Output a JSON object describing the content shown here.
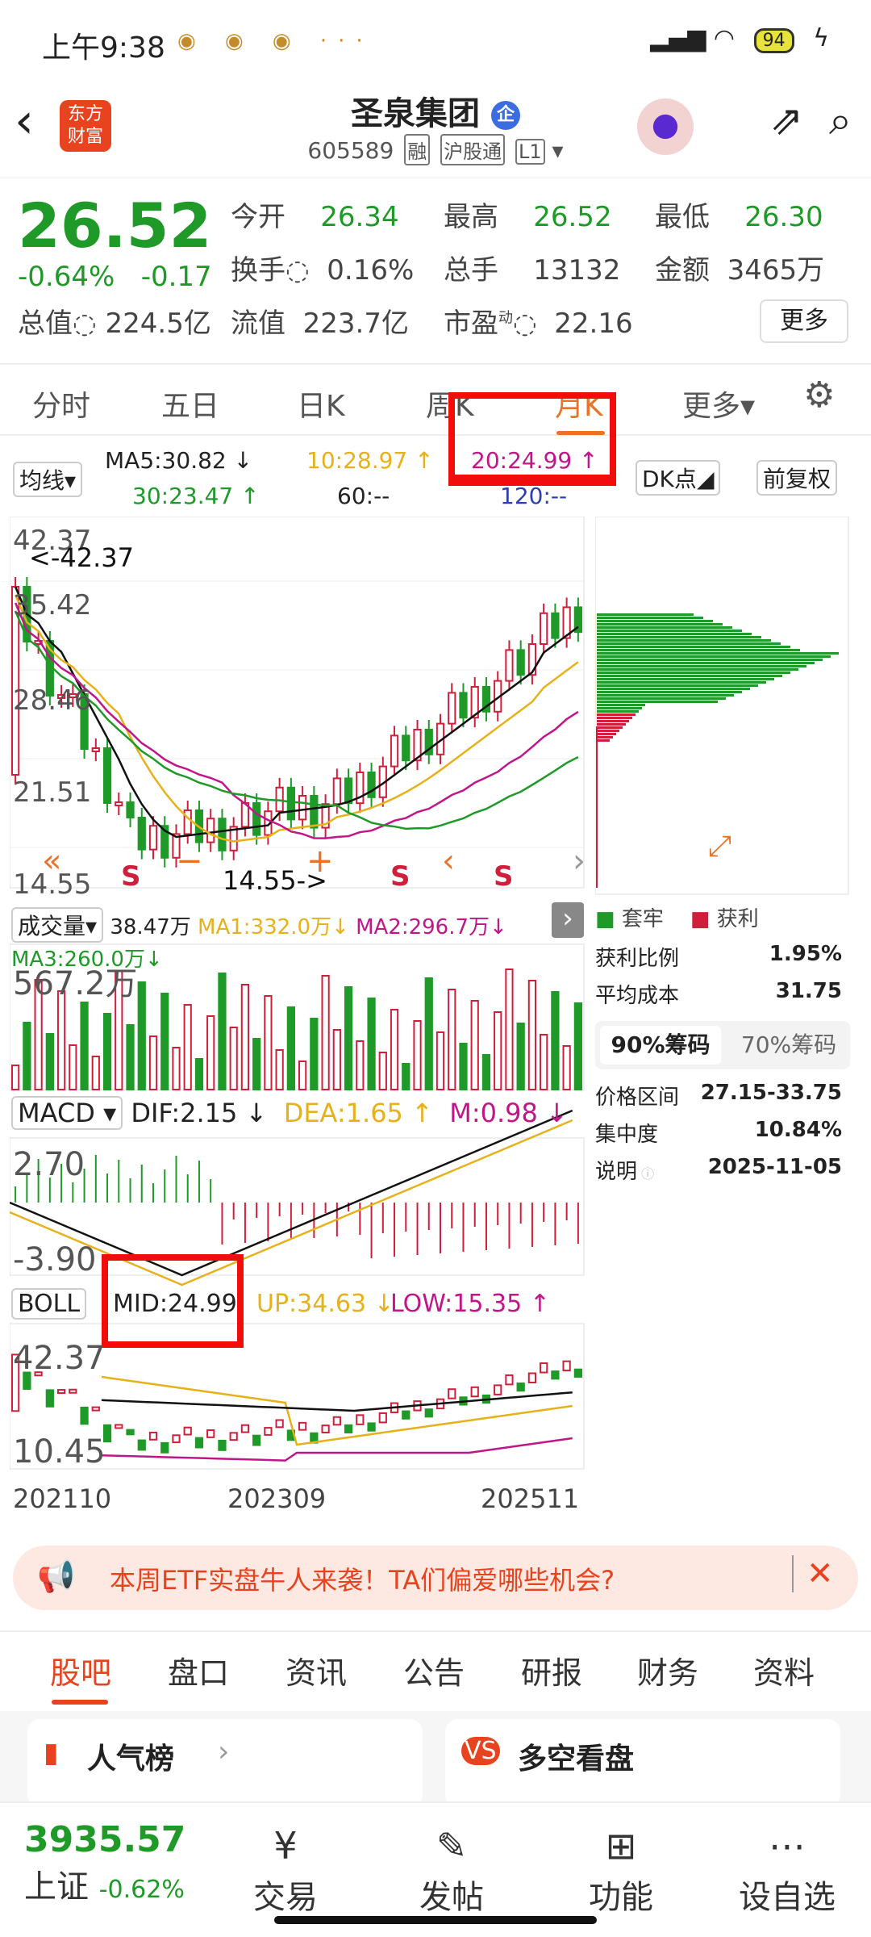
{
  "status_bar": {
    "time": "上午9:38",
    "battery": "94"
  },
  "header": {
    "logo_text": "东方财富",
    "title": "圣泉集团",
    "title_badge": "企",
    "code": "605589",
    "tags": [
      "融",
      "沪股通",
      "L1"
    ]
  },
  "quote": {
    "price": "26.52",
    "change_pct": "-0.64%",
    "change_abs": "-0.17",
    "fields": [
      {
        "label": "今开",
        "value": "26.34"
      },
      {
        "label": "最高",
        "value": "26.52"
      },
      {
        "label": "最低",
        "value": "26.30"
      },
      {
        "label": "换手",
        "value": "0.16%"
      },
      {
        "label": "总手",
        "value": "13132"
      },
      {
        "label": "金额",
        "value": "3465万"
      },
      {
        "label": "总值",
        "value": "224.5亿"
      },
      {
        "label": "流值",
        "value": "223.7亿"
      },
      {
        "label": "市盈",
        "value": "22.16",
        "sup": "动"
      }
    ],
    "more_label": "更多"
  },
  "tabs": [
    "分时",
    "五日",
    "日K",
    "周K",
    "月K",
    "更多"
  ],
  "active_tab": "月K",
  "ma_bar": {
    "selector": "均线",
    "ma5": "MA5:30.82 ↓",
    "ma10": "10:28.97 ↑",
    "ma20": "20:24.99 ↑",
    "ma30": "30:23.47 ↑",
    "ma60": "60:--",
    "ma120": "120:--",
    "dk": "DK点",
    "fq": "前复权"
  },
  "kline": {
    "high_label": "42.37",
    "high_marker": "<-42.37",
    "low_label": "14.55",
    "low_marker": "14.55->",
    "y_ticks": [
      "42.37",
      "35.42",
      "28.46",
      "21.51",
      "14.55"
    ],
    "s_marker": "S"
  },
  "volume": {
    "selector": "成交量",
    "v": "38.47万",
    "ma1": "MA1:332.0万↓",
    "ma2": "MA2:296.7万↓",
    "ma3": "MA3:260.0万↓",
    "max_label": "567.2万"
  },
  "macd": {
    "selector": "MACD",
    "dif": "DIF:2.15 ↓",
    "dea": "DEA:1.65 ↑",
    "m": "M:0.98 ↓",
    "top_label": "2.70",
    "bottom_label": "-3.90"
  },
  "boll": {
    "selector": "BOLL",
    "mid": "MID:24.99",
    "up": "UP:34.63 ↓",
    "low": "LOW:15.35 ↑",
    "top_label": "42.37",
    "bottom_label": "10.45"
  },
  "dates": [
    "202110",
    "202309",
    "202511"
  ],
  "chips": {
    "legend_trap": "套牢",
    "legend_profit": "获利",
    "rows": [
      {
        "label": "获利比例",
        "value": "1.95%"
      },
      {
        "label": "平均成本",
        "value": "31.75"
      }
    ],
    "tab90": "90%筹码",
    "tab70": "70%筹码",
    "rows2": [
      {
        "label": "价格区间",
        "value": "27.15-33.75"
      },
      {
        "label": "集中度",
        "value": "10.84%"
      },
      {
        "label": "说明",
        "value": "2025-11-05"
      }
    ]
  },
  "banner": {
    "text": "本周ETF实盘牛人来袭！TA们偏爱哪些机会?"
  },
  "bottom_tabs": [
    "股吧",
    "盘口",
    "资讯",
    "公告",
    "研报",
    "财务",
    "资料"
  ],
  "cards": [
    {
      "title": "人气榜"
    },
    {
      "title": "多空看盘"
    }
  ],
  "index": {
    "value": "3935.57",
    "name": "上证",
    "chg": "-0.62%"
  },
  "nav": [
    "交易",
    "发帖",
    "功能",
    "设自选"
  ],
  "colors": {
    "up": "#d01f3a",
    "down": "#1f9a29",
    "accent": "#e8742a",
    "highlight": "#f20d0d"
  }
}
